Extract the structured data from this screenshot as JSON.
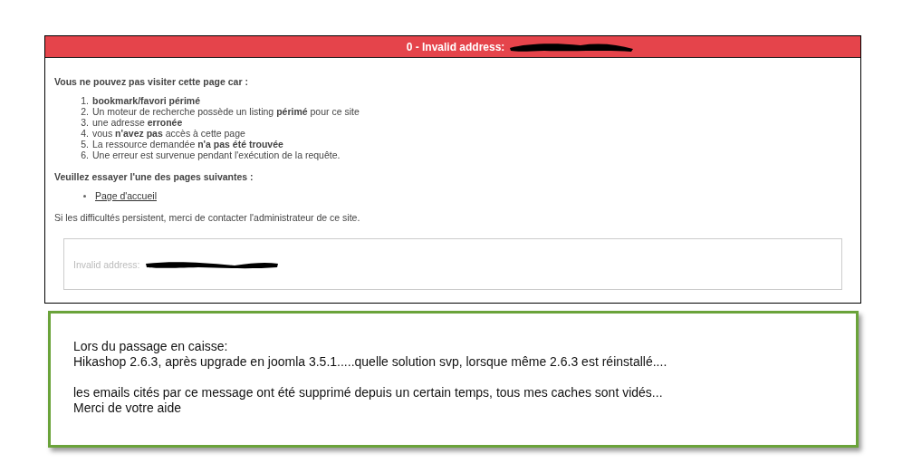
{
  "error_box": {
    "title": "0 - Invalid address:",
    "heading": "Vous ne pouvez pas visiter cette page car :",
    "reasons": [
      {
        "number": "1.",
        "text": "**bookmark/favori périmé**"
      },
      {
        "number": "2.",
        "text": "Un moteur de recherche possède un listing **périmé** pour ce site"
      },
      {
        "number": "3.",
        "text": "une adresse **erronée**"
      },
      {
        "number": "4.",
        "text": "vous **n'avez pas** accès à cette page"
      },
      {
        "number": "5.",
        "text": "La ressource demandée **n'a pas été trouvée**"
      },
      {
        "number": "6.",
        "text": "Une erreur est survenue pendant l'exécution de la requête."
      }
    ],
    "suggestion_heading": "Veuillez essayer l'une des pages suivantes :",
    "links": [
      "Page d'accueil"
    ],
    "contact": "Si les difficultés persistent, merci de contacter l'administrateur de ce site.",
    "message": "Invalid address:"
  },
  "note": {
    "paragraphs": [
      [
        "Lors du passage en caisse:",
        "Hikashop 2.6.3, après upgrade en joomla 3.5.1.....quelle solution svp, lorsque même 2.6.3 est réinstallé...."
      ],
      [
        "les emails cités par ce message ont été supprimé depuis un certain temps, tous mes caches sont vidés...",
        "Merci de votre aide"
      ]
    ]
  }
}
